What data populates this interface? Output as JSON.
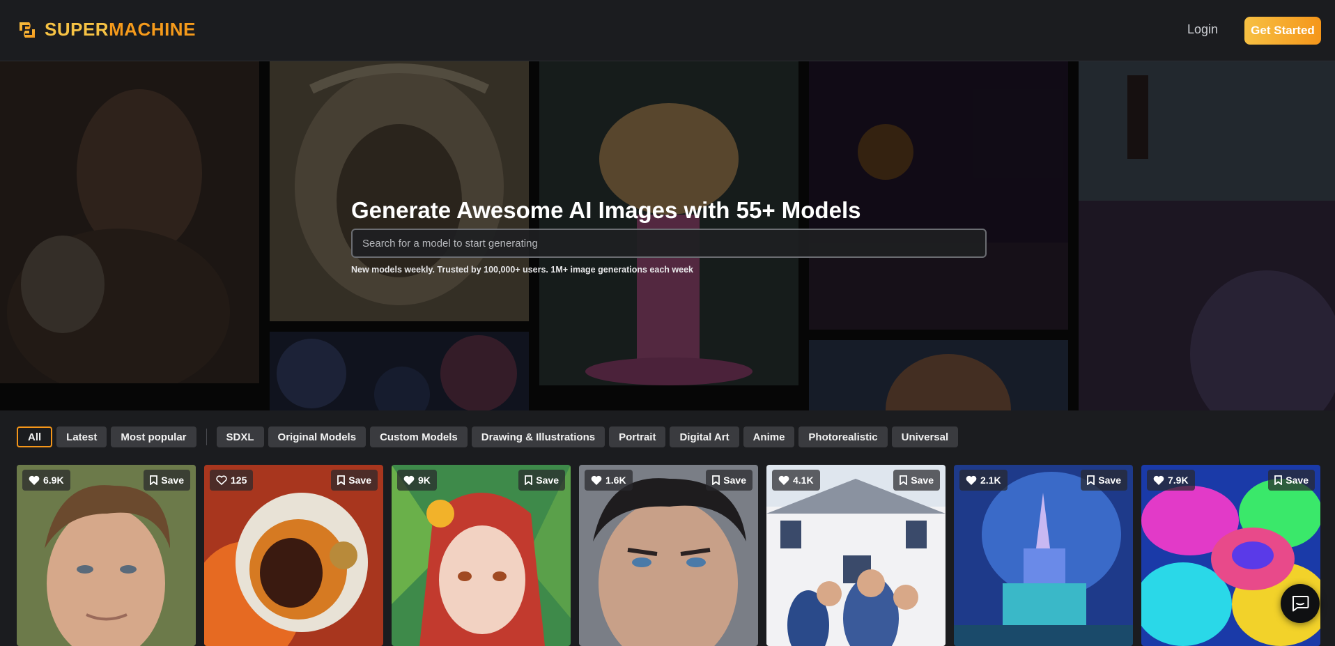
{
  "header": {
    "brand_part1": "SUPER",
    "brand_part2": "MACHINE",
    "login_label": "Login",
    "cta_label": "Get Started",
    "logo_icon": "supermachine-logo-icon"
  },
  "hero": {
    "title": "Generate Awesome AI Images with 55+ Models",
    "search_placeholder": "Search for a model to start generating",
    "subtitle": "New models weekly. Trusted by 100,000+ users. 1M+ image generations each week"
  },
  "filters": {
    "primary": [
      {
        "label": "All",
        "active": true
      },
      {
        "label": "Latest",
        "active": false
      },
      {
        "label": "Most popular",
        "active": false
      }
    ],
    "categories": [
      "SDXL",
      "Original Models",
      "Custom Models",
      "Drawing & Illustrations",
      "Portrait",
      "Digital Art",
      "Anime",
      "Photorealistic",
      "Universal"
    ]
  },
  "gallery": [
    {
      "likes": "6.9K",
      "liked": true,
      "save_label": "Save",
      "subject": "man-portrait"
    },
    {
      "likes": "125",
      "liked": false,
      "save_label": "Save",
      "subject": "astronaut-fire"
    },
    {
      "likes": "9K",
      "liked": true,
      "save_label": "Save",
      "subject": "anime-girl"
    },
    {
      "likes": "1.6K",
      "liked": true,
      "save_label": "Save",
      "subject": "man-closeup"
    },
    {
      "likes": "4.1K",
      "liked": true,
      "save_label": "Save",
      "subject": "family-house"
    },
    {
      "likes": "2.1K",
      "liked": true,
      "save_label": "Save",
      "subject": "castle-night"
    },
    {
      "likes": "7.9K",
      "liked": true,
      "save_label": "Save",
      "subject": "neon-flower"
    }
  ],
  "colors": {
    "accent_start": "#f6c043",
    "accent_end": "#f5961a",
    "background": "#1b1c1f",
    "chip": "#3a3b3f"
  },
  "chat_icon": "chat-bubble-icon"
}
